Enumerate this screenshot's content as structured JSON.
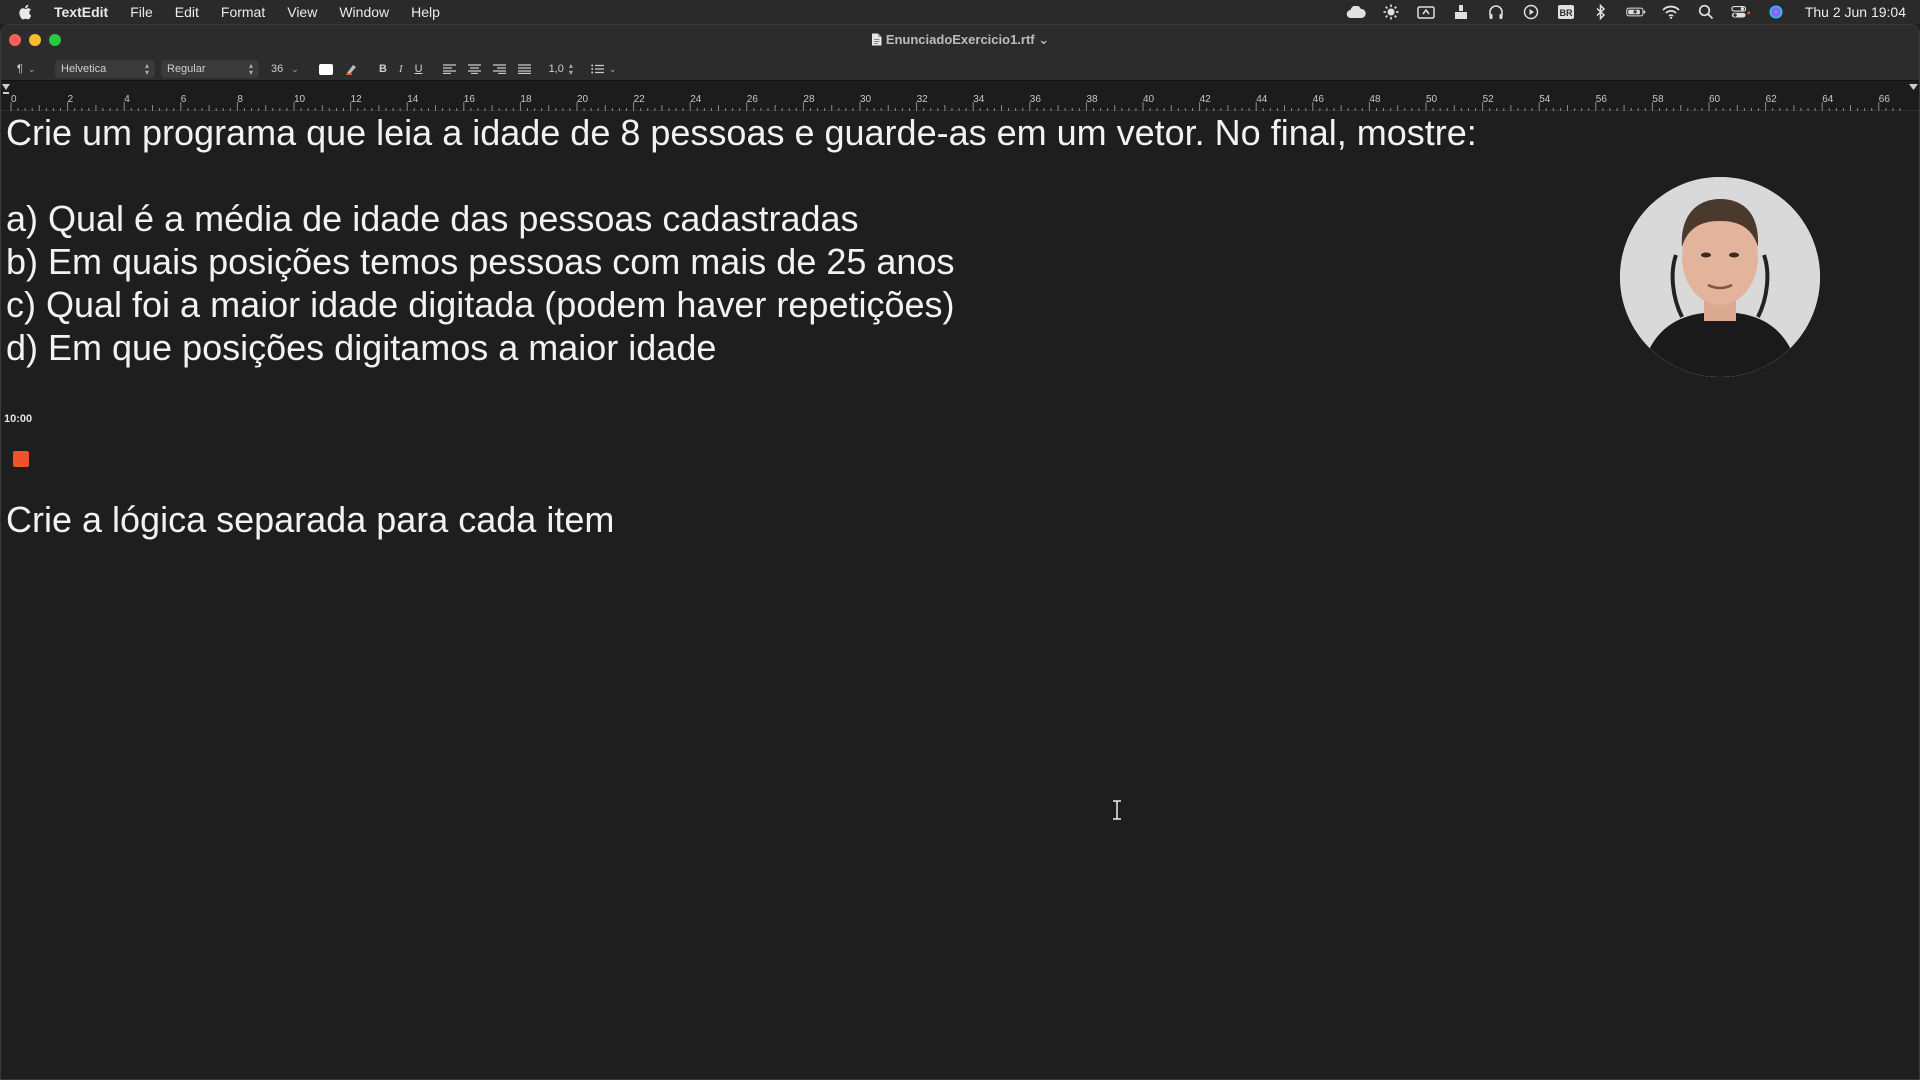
{
  "menubar": {
    "app_name": "TextEdit",
    "items": [
      "File",
      "Edit",
      "Format",
      "View",
      "Window",
      "Help"
    ],
    "clock": "Thu 2 Jun  19:04",
    "status_icons": [
      "cloud-icon",
      "brightness-icon",
      "screen-share-icon",
      "upload-icon",
      "headphones-icon",
      "play-icon",
      "keyboard-input-icon",
      "bluetooth-icon",
      "battery-icon",
      "wifi-icon",
      "search-icon",
      "control-center-icon",
      "siri-icon"
    ],
    "input_source": "BR"
  },
  "window": {
    "title": "EnunciadoExercicio1.rtf",
    "title_chevron": "⌄"
  },
  "toolbar": {
    "paragraph_style": "¶",
    "font_family": "Helvetica",
    "font_style": "Regular",
    "font_size": "36",
    "bold": "B",
    "italic": "I",
    "underline": "U",
    "line_spacing": "1,0"
  },
  "ruler": {
    "labels": [
      "0",
      "2",
      "4",
      "6",
      "8",
      "10",
      "12",
      "14",
      "16",
      "18",
      "20",
      "22",
      "24",
      "26",
      "28",
      "30",
      "32",
      "34",
      "36",
      "38",
      "40",
      "42",
      "44",
      "46",
      "48",
      "50",
      "52",
      "54",
      "56",
      "58",
      "60",
      "62",
      "64",
      "66"
    ]
  },
  "document": {
    "line1": "Crie um programa que leia a idade de 8 pessoas e guarde-as em um vetor. No final, mostre:",
    "item_a": "a) Qual é a média de idade das pessoas cadastradas",
    "item_b": "b) Em quais posições temos pessoas com mais de 25 anos",
    "item_c": "c) Qual foi a maior idade digitada (podem haver repetições)",
    "item_d": "d) Em que posições digitamos a maior idade",
    "timer": "10:00",
    "footer": "Crie a lógica separada para cada item"
  },
  "colors": {
    "background": "#1e1e1e",
    "text": "#f2f2f2",
    "record_dot": "#f0522c"
  }
}
